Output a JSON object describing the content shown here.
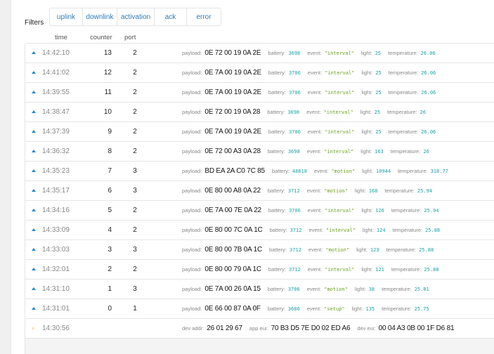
{
  "filters": {
    "label": "Filters",
    "buttons": [
      "uplink",
      "downlink",
      "activation",
      "ack",
      "error"
    ]
  },
  "columns": {
    "time": "time",
    "counter": "counter",
    "port": "port"
  },
  "field_labels": {
    "payload": "payload:",
    "battery": "battery:",
    "event": "event:",
    "light": "light:",
    "temperature": "temperature:",
    "dev_addr": "dev addr:",
    "app_eui": "app eui:",
    "dev_eui": "dev eui:"
  },
  "colors": {
    "uplink_arrow": "#1a8ad4",
    "activation_icon": "#f5c465",
    "number_value": "#1aa3a8",
    "string_value": "#6ca21c",
    "filter_link": "#2a7bbf"
  },
  "uplinks": [
    {
      "time": "14:42:10",
      "counter": "13",
      "port": "2",
      "payload": "0E 72 00 19 0A 2E",
      "battery": "3698",
      "event": "\"interval\"",
      "light": "25",
      "temperature": "26.06"
    },
    {
      "time": "14:41:02",
      "counter": "12",
      "port": "2",
      "payload": "0E 7A 00 19 0A 2E",
      "battery": "3706",
      "event": "\"interval\"",
      "light": "25",
      "temperature": "26.06"
    },
    {
      "time": "14:39:55",
      "counter": "11",
      "port": "2",
      "payload": "0E 7A 00 19 0A 2E",
      "battery": "3706",
      "event": "\"interval\"",
      "light": "25",
      "temperature": "26.06"
    },
    {
      "time": "14:38:47",
      "counter": "10",
      "port": "2",
      "payload": "0E 72 00 19 0A 28",
      "battery": "3698",
      "event": "\"interval\"",
      "light": "25",
      "temperature": "26"
    },
    {
      "time": "14:37:39",
      "counter": "9",
      "port": "2",
      "payload": "0E 7A 00 19 0A 2E",
      "battery": "3706",
      "event": "\"interval\"",
      "light": "25",
      "temperature": "26.06"
    },
    {
      "time": "14:36:32",
      "counter": "8",
      "port": "2",
      "payload": "0E 72 00 A3 0A 28",
      "battery": "3698",
      "event": "\"interval\"",
      "light": "163",
      "temperature": "26"
    },
    {
      "time": "14:35:23",
      "counter": "7",
      "port": "3",
      "payload": "BD EA 2A C0 7C 85",
      "battery": "48618",
      "event": "\"motion\"",
      "light": "10944",
      "temperature": "318.77"
    },
    {
      "time": "14:35:17",
      "counter": "6",
      "port": "3",
      "payload": "0E 80 00 A8 0A 22",
      "battery": "3712",
      "event": "\"motion\"",
      "light": "168",
      "temperature": "25.94"
    },
    {
      "time": "14:34:16",
      "counter": "5",
      "port": "2",
      "payload": "0E 7A 00 7E 0A 22",
      "battery": "3706",
      "event": "\"interval\"",
      "light": "126",
      "temperature": "25.94"
    },
    {
      "time": "14:33:09",
      "counter": "4",
      "port": "2",
      "payload": "0E 80 00 7C 0A 1C",
      "battery": "3712",
      "event": "\"interval\"",
      "light": "124",
      "temperature": "25.88"
    },
    {
      "time": "14:33:03",
      "counter": "3",
      "port": "3",
      "payload": "0E 80 00 7B 0A 1C",
      "battery": "3712",
      "event": "\"motion\"",
      "light": "123",
      "temperature": "25.88"
    },
    {
      "time": "14:32:01",
      "counter": "2",
      "port": "2",
      "payload": "0E 80 00 79 0A 1C",
      "battery": "3712",
      "event": "\"interval\"",
      "light": "121",
      "temperature": "25.88"
    },
    {
      "time": "14:31:10",
      "counter": "1",
      "port": "3",
      "payload": "0E 7A 00 26 0A 15",
      "battery": "3706",
      "event": "\"motion\"",
      "light": "38",
      "temperature": "25.81"
    },
    {
      "time": "14:31:01",
      "counter": "0",
      "port": "1",
      "payload": "0E 66 00 87 0A 0F",
      "battery": "3686",
      "event": "\"setup\"",
      "light": "135",
      "temperature": "25.75"
    }
  ],
  "activation": {
    "time": "14:30:56",
    "dev_addr": "26 01 29 67",
    "app_eui": "70 B3 D5 7E D0 02 ED A6",
    "dev_eui": "00 04 A3 0B 00 1F D6 81"
  }
}
